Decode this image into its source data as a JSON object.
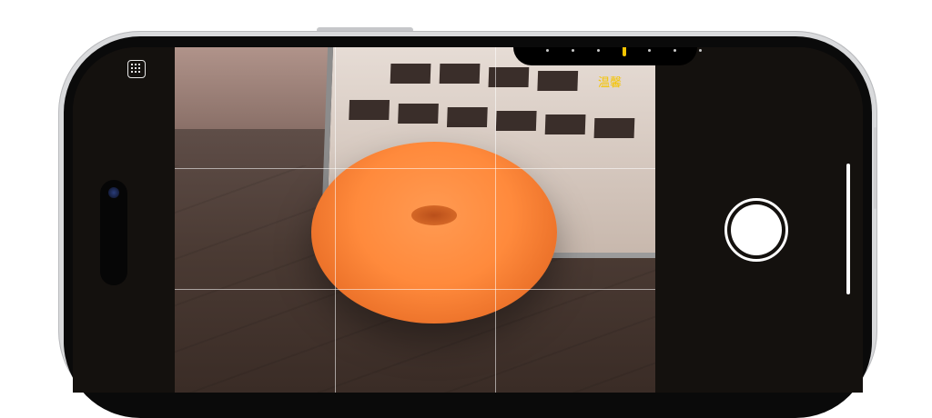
{
  "camera": {
    "filter_label": "温馨",
    "filter_dots_count": 7,
    "active_filter_index": 3
  },
  "icons": {
    "grid_icon": "grid-icon",
    "shutter": "shutter-button-icon",
    "front_camera": "camera-lens-icon"
  },
  "colors": {
    "accent": "#f5c400",
    "shutter": "#ffffff"
  }
}
